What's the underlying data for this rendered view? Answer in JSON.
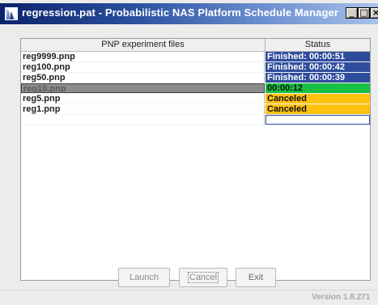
{
  "window": {
    "title": "regression.pat - Probabilistic NAS Platform Schedule Manager",
    "minimize_label": "_",
    "maximize_label": "□",
    "close_label": "×"
  },
  "table": {
    "headers": {
      "files": "PNP experiment files",
      "status": "Status"
    },
    "rows": [
      {
        "file": "reg9999.pnp",
        "status": "Finished: 00:00:51",
        "state": "finished"
      },
      {
        "file": "reg100.pnp",
        "status": "Finished: 00:00:42",
        "state": "finished"
      },
      {
        "file": "reg50.pnp",
        "status": "Finished: 00:00:39",
        "state": "finished"
      },
      {
        "file": "reg10.pnp",
        "status": "00:00:12",
        "state": "running",
        "selected": true
      },
      {
        "file": "reg5.pnp",
        "status": "Canceled",
        "state": "canceled"
      },
      {
        "file": "reg1.pnp",
        "status": "Canceled",
        "state": "canceled"
      },
      {
        "file": "",
        "status": "",
        "state": "empty"
      }
    ]
  },
  "buttons": {
    "launch": "Launch",
    "cancel": "Cancel",
    "exit": "Exit"
  },
  "footer": {
    "version": "Version 1.8.271"
  },
  "colors": {
    "finished": "#2f4d9d",
    "running": "#18c044",
    "canceled": "#ffc20e",
    "titlebar": "#0a236b"
  },
  "icons": {
    "app": "app-icon"
  }
}
